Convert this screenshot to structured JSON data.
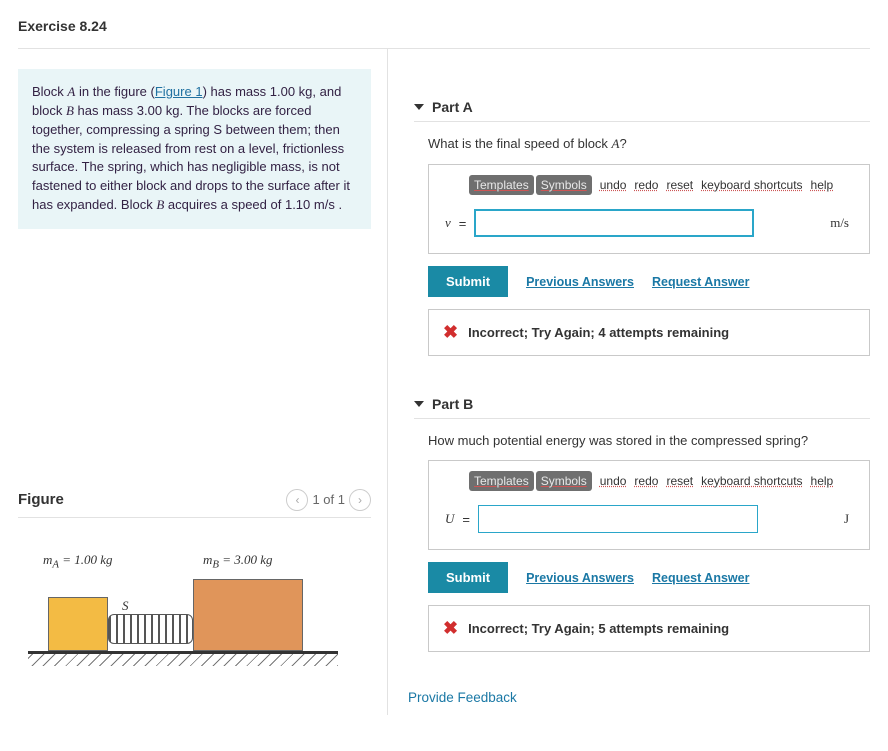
{
  "title": "Exercise 8.24",
  "problem": {
    "pre1": "Block ",
    "varA": "A",
    "mid1": " in the figure (",
    "fig_link": "Figure 1",
    "mid2": ") has mass ",
    "massA": "1.00 kg",
    "mid3": ", and block ",
    "varB": "B",
    "mid4": " has mass ",
    "massB": "3.00 kg",
    "mid5": ". The blocks are forced together, compressing a spring ",
    "varS": "S",
    "mid6": " between them; then the system is released from rest on a level, frictionless surface. The spring, which has negligible mass, is not fastened to either block and drops to the surface after it has expanded. Block ",
    "varB2": "B",
    "mid7": " acquires a speed of ",
    "speedB": "1.10 m/s",
    "end": " ."
  },
  "figure": {
    "heading": "Figure",
    "pager": "1 of 1",
    "labelA_pre": "m",
    "labelA_sub": "A",
    "labelA_val": " = 1.00 kg",
    "labelB_pre": "m",
    "labelB_sub": "B",
    "labelB_val": " = 3.00 kg",
    "labelS": "S"
  },
  "toolbar": {
    "templates": "Templates",
    "symbols": "Symbols",
    "undo": "undo",
    "redo": "redo",
    "reset": "reset",
    "keyboard": "keyboard shortcuts",
    "help": "help"
  },
  "actions": {
    "submit": "Submit",
    "prev": "Previous Answers",
    "request": "Request Answer"
  },
  "partA": {
    "label": "Part A",
    "question_pre": "What is the final speed of block ",
    "question_var": "A",
    "question_post": "?",
    "var": "v",
    "eq": " = ",
    "unit": "m/s",
    "feedback": "Incorrect; Try Again; 4 attempts remaining"
  },
  "partB": {
    "label": "Part B",
    "question": "How much potential energy was stored in the compressed spring?",
    "var": "U",
    "eq": " = ",
    "unit": "J",
    "feedback": "Incorrect; Try Again; 5 attempts remaining"
  },
  "footer": {
    "provide": "Provide Feedback"
  }
}
